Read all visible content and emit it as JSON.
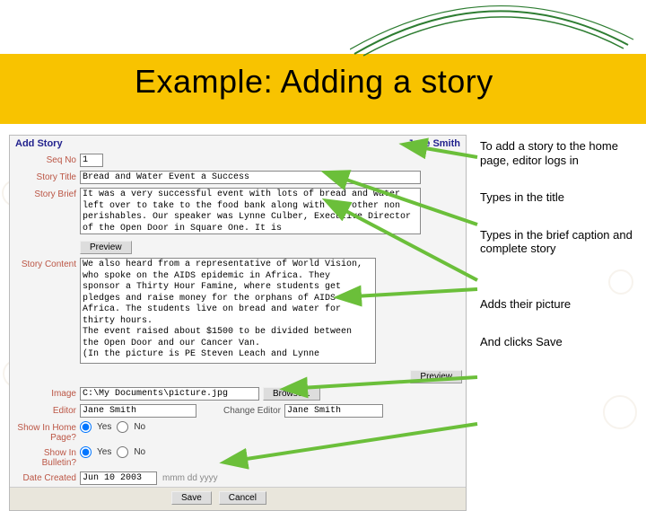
{
  "slide": {
    "title": "Example: Adding a story"
  },
  "form": {
    "heading": "Add Story",
    "user_display": "Jane Smith",
    "labels": {
      "seq_no": "Seq No",
      "story_title": "Story Title",
      "story_brief": "Story Brief",
      "story_content": "Story Content",
      "image": "Image",
      "editor": "Editor",
      "change_editor": "Change Editor",
      "show_home": "Show In Home Page?",
      "show_bulletin": "Show In Bulletin?",
      "date_created": "Date Created"
    },
    "values": {
      "seq_no": "1",
      "story_title": "Bread and Water Event a Success",
      "story_brief": "It was a very successful event with lots of bread and water left over to take to the food bank along with the other non perishables. Our speaker was Lynne Culber, Executive Director of the Open Door in Square One. It is",
      "story_content": "We also heard from a representative of World Vision, who spoke on the AIDS epidemic in Africa. They sponsor a Thirty Hour Famine, where students get pledges and raise money for the orphans of AIDS in Africa. The students live on bread and water for thirty hours.\nThe event raised about $1500 to be divided between the Open Door and our Cancer Van.\n(In the picture is PE Steven Leach and Lynne",
      "image_path": "C:\\My Documents\\picture.jpg",
      "editor": "Jane Smith",
      "change_editor_value": "Jane Smith",
      "date_created": "Jun 10 2003",
      "date_hint": "mmm dd yyyy"
    },
    "buttons": {
      "preview": "Preview",
      "browse": "Browse...",
      "save": "Save",
      "cancel": "Cancel"
    },
    "radios": {
      "yes": "Yes",
      "no": "No"
    }
  },
  "notes": {
    "n1": "To add a story to the home page, editor logs in",
    "n2": "Types in the title",
    "n3": "Types in the brief caption and complete story",
    "n4": "Adds their picture",
    "n5": "And clicks Save"
  }
}
